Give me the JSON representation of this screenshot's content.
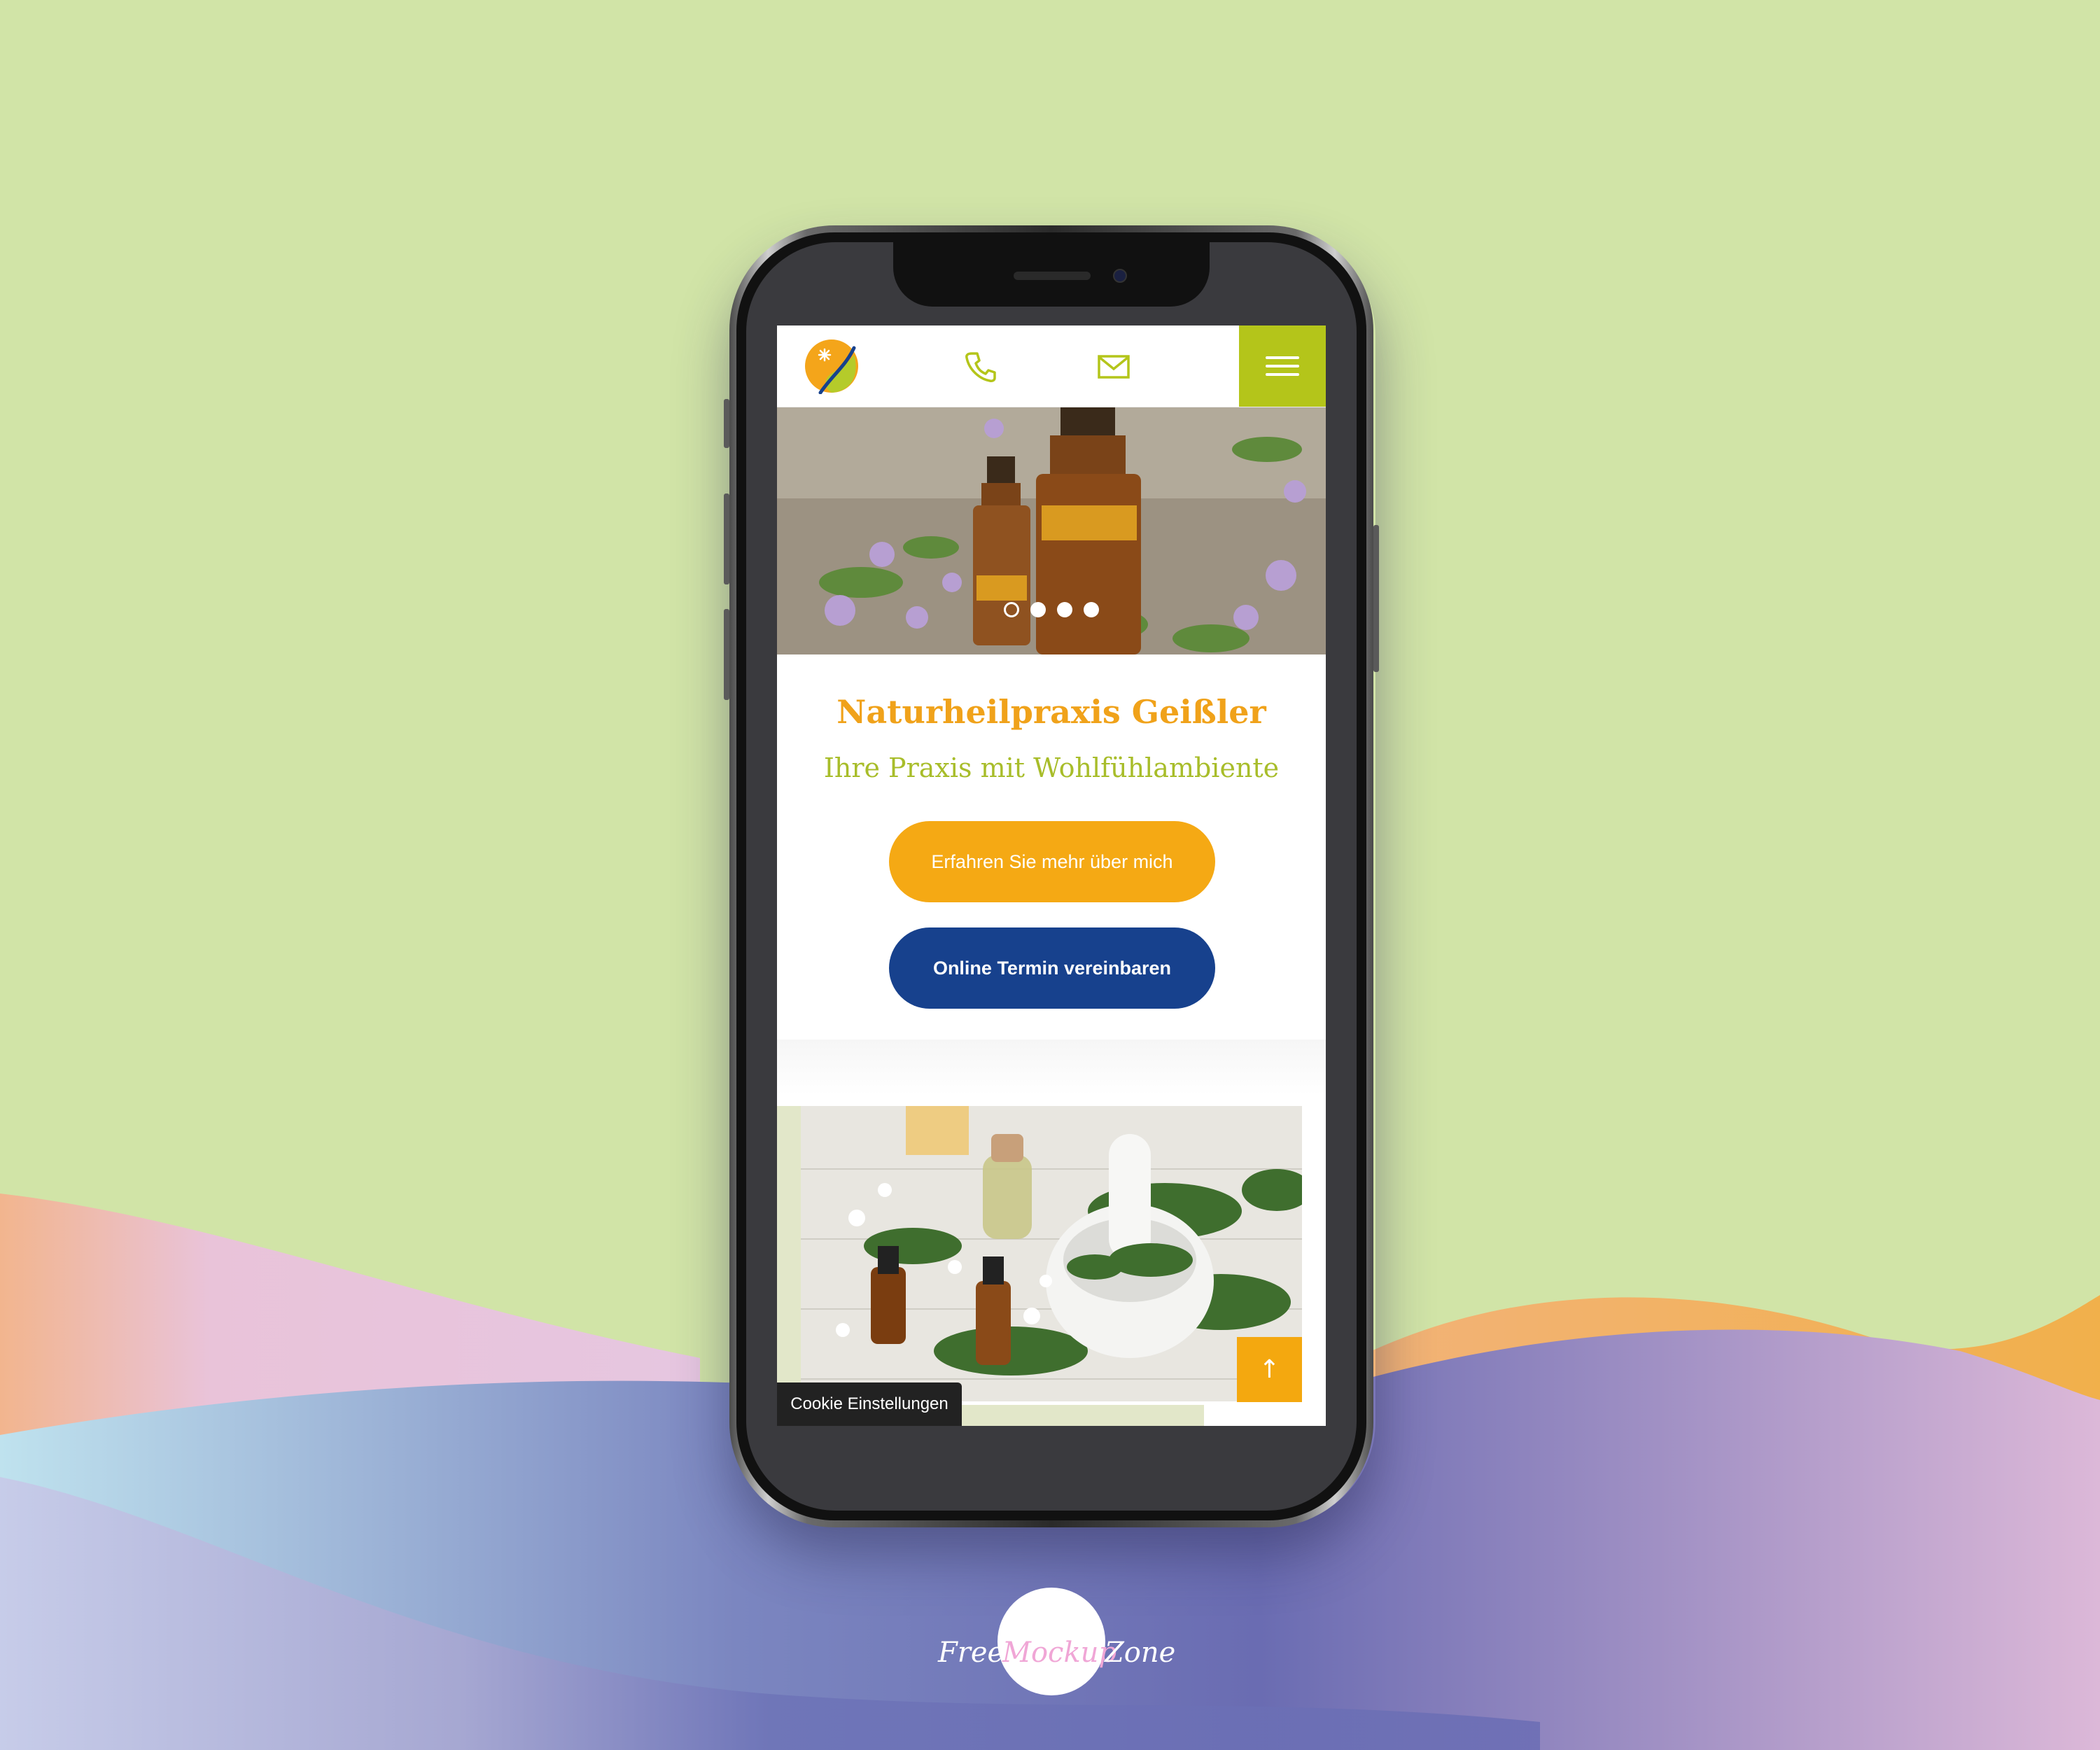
{
  "colors": {
    "background": "#d1e4a7",
    "accent_green": "#b4c51a",
    "accent_orange": "#f5a914",
    "accent_blue": "#17418d",
    "title_orange": "#f0a21a",
    "subtitle_green": "#a8bd2a"
  },
  "header": {
    "logo_icon": "praxis-logo-icon",
    "phone_icon": "phone-icon",
    "mail_icon": "mail-icon",
    "menu_icon": "hamburger-menu-icon"
  },
  "hero": {
    "slider_total": 4,
    "slider_active_index": 0
  },
  "main": {
    "title": "Naturheilpraxis Geißler",
    "subtitle": "Ihre Praxis mit Wohlfühlambiente",
    "primary_button": "Erfahren Sie mehr über mich",
    "secondary_button": "Online Termin vereinbaren"
  },
  "footer": {
    "cookie_label": "Cookie Einstellungen",
    "scroll_top_icon": "arrow-up-icon",
    "scroll_top_glyph": "↑"
  },
  "watermark": {
    "part1": "Free",
    "part2": "Mockup",
    "part3": "Zone"
  }
}
